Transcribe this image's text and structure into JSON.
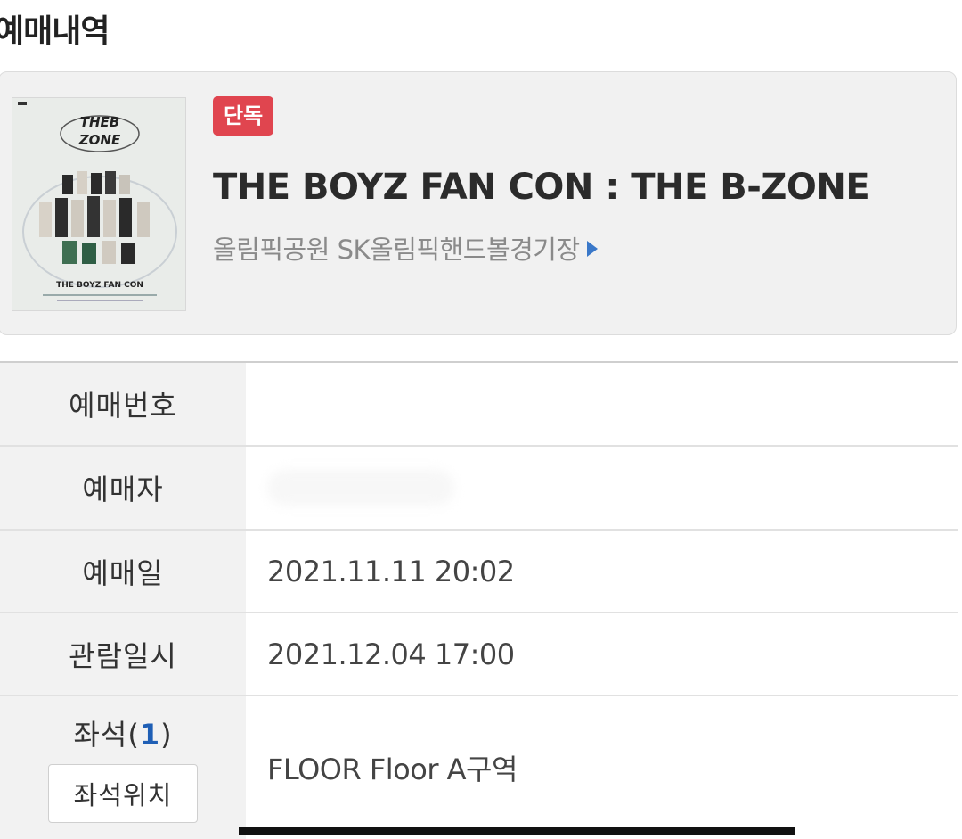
{
  "page": {
    "title": "예매내역"
  },
  "event": {
    "badge": "단독",
    "title": "THE BOYZ FAN CON : THE B-ZONE",
    "venue": "올림픽공원 SK올림픽핸드볼경기장",
    "poster": {
      "logo_line1": "THEB",
      "logo_line2": "ZONE",
      "caption": "THE BOYZ FAN CON"
    }
  },
  "details": {
    "reservation_number": {
      "label": "예매번호",
      "value": ""
    },
    "booker": {
      "label": "예매자",
      "value": ""
    },
    "booking_date": {
      "label": "예매일",
      "value": "2021.11.11 20:02"
    },
    "show_datetime": {
      "label": "관람일시",
      "value": "2021.12.04 17:00"
    },
    "seat": {
      "label": "좌석",
      "count": "1",
      "button_label": "좌석위치",
      "value": "FLOOR Floor A구역"
    }
  },
  "colors": {
    "badge": "#e0454f",
    "link_arrow": "#3a78c9",
    "seat_count": "#1f5fb5"
  }
}
